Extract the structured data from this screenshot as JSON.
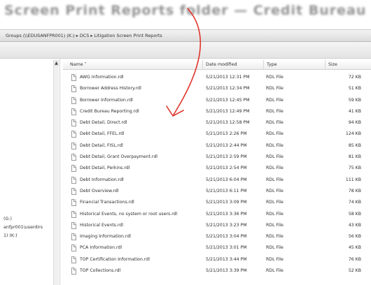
{
  "caption": "Screen Print Reports folder — Credit Bureau Reporting",
  "address": {
    "path": "Groups (\\\\EDUSANFPR001) (K:)  ▸  DCS  ▸  Litigation Screen Print Reports"
  },
  "nav": {
    "items": [
      {
        "label": "(G:)"
      },
      {
        "label": "anfpr001\\userdirs"
      },
      {
        "label": "1) (K:)"
      }
    ]
  },
  "columns": {
    "name": "Name",
    "date": "Date modified",
    "type": "Type",
    "size": "Size"
  },
  "files": [
    {
      "name": "AWG Information.rdl",
      "date": "5/21/2013 12:31 PM",
      "type": "RDL File",
      "size": "72 KB"
    },
    {
      "name": "Borrower Address History.rdl",
      "date": "5/21/2013 12:34 PM",
      "type": "RDL File",
      "size": "51 KB"
    },
    {
      "name": "Borrower Information.rdl",
      "date": "5/21/2013 12:45 PM",
      "type": "RDL File",
      "size": "59 KB"
    },
    {
      "name": "Credit Bureau Reporting.rdl",
      "date": "5/21/2013 12:49 PM",
      "type": "RDL File",
      "size": "41 KB"
    },
    {
      "name": "Debt Detail, Direct.rdl",
      "date": "5/21/2013 12:58 PM",
      "type": "RDL File",
      "size": "94 KB"
    },
    {
      "name": "Debt Detail, FFEL.rdl",
      "date": "5/21/2013 2:26 PM",
      "type": "RDL File",
      "size": "124 KB"
    },
    {
      "name": "Debt Detail, FISL.rdl",
      "date": "5/21/2013 2:44 PM",
      "type": "RDL File",
      "size": "85 KB"
    },
    {
      "name": "Debt Detail, Grant Overpayment.rdl",
      "date": "5/21/2013 2:59 PM",
      "type": "RDL File",
      "size": "81 KB"
    },
    {
      "name": "Debt Detail, Perkins.rdl",
      "date": "5/21/2013 2:54 PM",
      "type": "RDL File",
      "size": "75 KB"
    },
    {
      "name": "Debt Information.rdl",
      "date": "5/21/2013 6:04 PM",
      "type": "RDL File",
      "size": "111 KB"
    },
    {
      "name": "Debt Overview.rdl",
      "date": "5/21/2013 6:11 PM",
      "type": "RDL File",
      "size": "78 KB"
    },
    {
      "name": "Financial Transactions.rdl",
      "date": "5/21/2013 3:09 PM",
      "type": "RDL File",
      "size": "74 KB"
    },
    {
      "name": "Historical Events, no system or root users.rdl",
      "date": "5/21/2013 3:36 PM",
      "type": "RDL File",
      "size": "58 KB"
    },
    {
      "name": "Historical Events.rdl",
      "date": "5/21/2013 3:23 PM",
      "type": "RDL File",
      "size": "43 KB"
    },
    {
      "name": "Imaging Information.rdl",
      "date": "5/21/2013 3:04 PM",
      "type": "RDL File",
      "size": "56 KB"
    },
    {
      "name": "PCA Information.rdl",
      "date": "5/21/2013 3:01 PM",
      "type": "RDL File",
      "size": "45 KB"
    },
    {
      "name": "TOP Certification Information.rdl",
      "date": "5/21/2013 3:44 PM",
      "type": "RDL File",
      "size": "76 KB"
    },
    {
      "name": "TOP Collections.rdl",
      "date": "5/21/2013 3:39 PM",
      "type": "RDL File",
      "size": "52 KB"
    }
  ],
  "colors": {
    "annotation_arrow": "#e0352b"
  }
}
